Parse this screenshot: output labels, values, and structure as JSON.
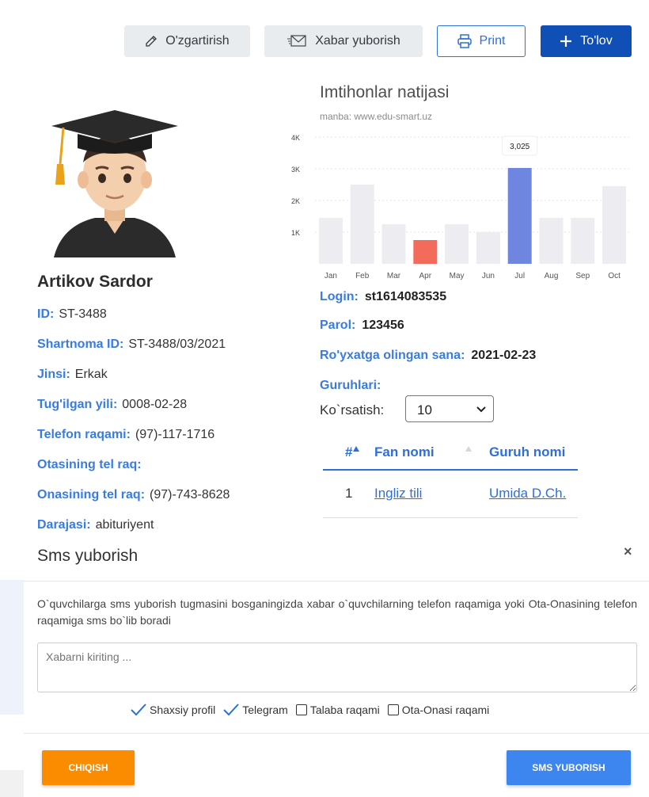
{
  "toolbar": {
    "edit_label": "O'zgartirish",
    "message_label": "Xabar yuborish",
    "print_label": "Print",
    "payment_label": "To'lov"
  },
  "profile": {
    "name": "Artikov Sardor",
    "fields": [
      {
        "label": "ID:",
        "value": "ST-3488"
      },
      {
        "label": "Shartnoma ID:",
        "value": "ST-3488/03/2021"
      },
      {
        "label": "Jinsi:",
        "value": "Erkak"
      },
      {
        "label": "Tug'ilgan yili:",
        "value": "0008-02-28"
      },
      {
        "label": "Telefon raqami:",
        "value": "(97)-117-1716"
      },
      {
        "label": "Otasining tel raq:",
        "value": ""
      },
      {
        "label": "Onasining tel raq:",
        "value": "(97)-743-8628"
      },
      {
        "label": "Darajasi:",
        "value": "abituriyent"
      }
    ]
  },
  "chart_data": {
    "type": "bar",
    "title": "Imtihonlar natijasi",
    "subtitle": "manba: www.edu-smart.uz",
    "categories": [
      "Jan",
      "Feb",
      "Mar",
      "Apr",
      "May",
      "Jun",
      "Jul",
      "Aug",
      "Sep",
      "Oct"
    ],
    "values": [
      1450,
      2500,
      1250,
      750,
      1250,
      1000,
      3025,
      1450,
      1450,
      2450
    ],
    "highlight": {
      "Apr": "#f26b5b",
      "Jul": "#6e86e0"
    },
    "default_color": "#ededf1",
    "yticks": [
      "1K",
      "2K",
      "3K",
      "4K"
    ],
    "ylim": [
      0,
      4000
    ],
    "tooltip": {
      "category": "Jul",
      "text": "3,025"
    },
    "grid": true
  },
  "account": {
    "login_label": "Login:",
    "login_value": "st1614083535",
    "password_label": "Parol:",
    "password_value": "123456",
    "registered_label": "Ro'yxatga olingan sana:",
    "registered_value": "2021-02-23",
    "groups_label": "Guruhlari:"
  },
  "table": {
    "show_label": "Ko`rsatish:",
    "page_size": "10",
    "headers": [
      "#",
      "Fan nomi",
      "Guruh nomi"
    ],
    "rows": [
      {
        "num": "1",
        "subject": "Ingliz tili",
        "group": "Umida D.Ch."
      }
    ]
  },
  "modal": {
    "title": "Sms yuborish",
    "close": "×",
    "description": "O`quvchilarga sms yuborish tugmasini bosganingizda xabar o`quvchilarning telefon raqamiga yoki Ota-Onasining telefon raqamiga sms bo`lib boradi",
    "placeholder": "Xabarni kiriting ...",
    "options": [
      {
        "label": "Shaxsiy profil",
        "checked": true
      },
      {
        "label": "Telegram",
        "checked": true
      },
      {
        "label": "Talaba raqami",
        "checked": false
      },
      {
        "label": "Ota-Onasi raqami",
        "checked": false
      }
    ],
    "exit_label": "CHIQISH",
    "send_label": "SMS YUBORISH"
  }
}
